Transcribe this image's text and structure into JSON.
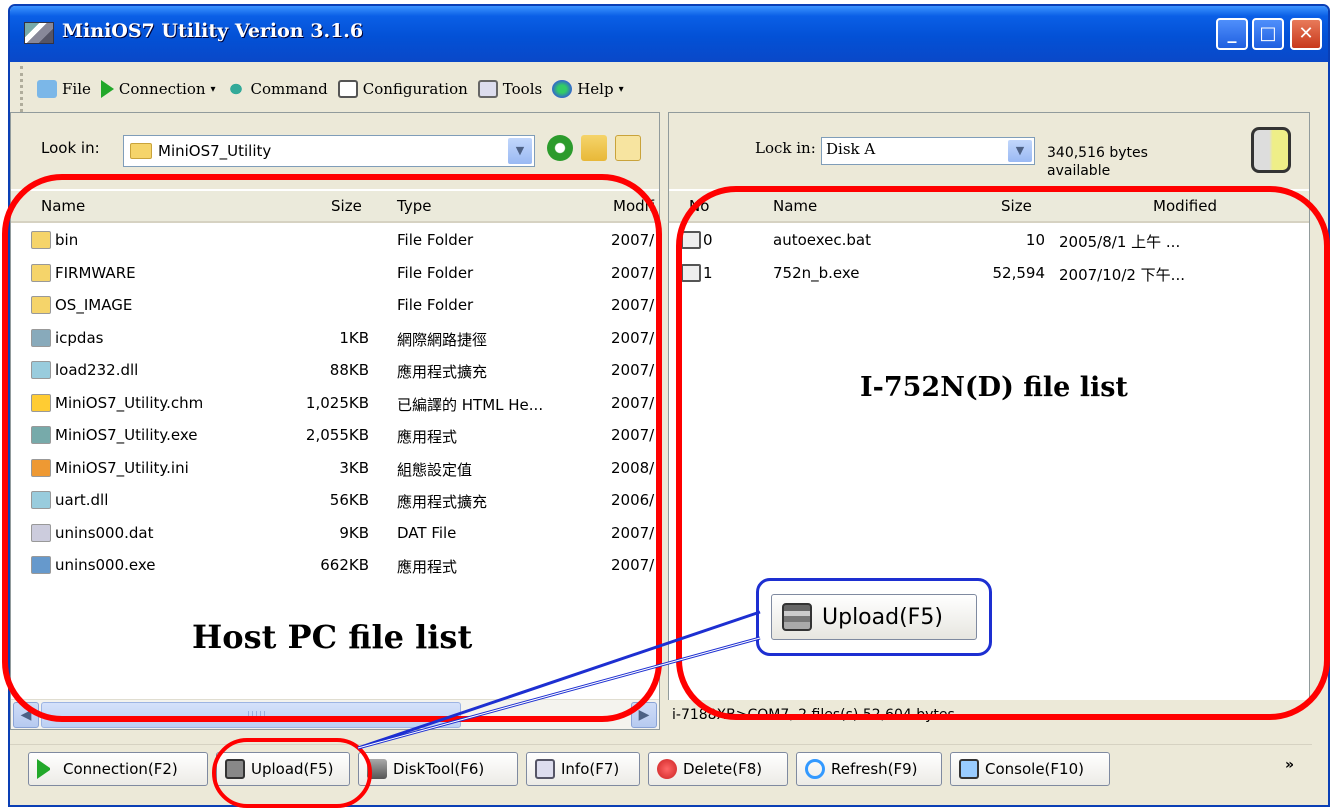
{
  "window": {
    "title": "MiniOS7 Utility Verion 3.1.6"
  },
  "menu": {
    "file": "File",
    "connection": "Connection",
    "command": "Command",
    "configuration": "Configuration",
    "tools": "Tools",
    "help": "Help",
    "arrow": "▾"
  },
  "left": {
    "look_label": "Look in:",
    "look_value": "MiniOS7_Utility",
    "headers": {
      "name": "Name",
      "size": "Size",
      "type": "Type",
      "modified": "Modif"
    },
    "rows": [
      {
        "name": "bin",
        "size": "",
        "type": "File Folder",
        "modified": "2007/"
      },
      {
        "name": "FIRMWARE",
        "size": "",
        "type": "File Folder",
        "modified": "2007/"
      },
      {
        "name": "OS_IMAGE",
        "size": "",
        "type": "File Folder",
        "modified": "2007/"
      },
      {
        "name": "icpdas",
        "size": "1KB",
        "type": "網際網路捷徑",
        "modified": "2007/"
      },
      {
        "name": "load232.dll",
        "size": "88KB",
        "type": "應用程式擴充",
        "modified": "2007/"
      },
      {
        "name": "MiniOS7_Utility.chm",
        "size": "1,025KB",
        "type": "已編譯的 HTML He...",
        "modified": "2007/"
      },
      {
        "name": "MiniOS7_Utility.exe",
        "size": "2,055KB",
        "type": "應用程式",
        "modified": "2007/"
      },
      {
        "name": "MiniOS7_Utility.ini",
        "size": "3KB",
        "type": "組態設定值",
        "modified": "2008/"
      },
      {
        "name": "uart.dll",
        "size": "56KB",
        "type": "應用程式擴充",
        "modified": "2006/"
      },
      {
        "name": "unins000.dat",
        "size": "9KB",
        "type": "DAT File",
        "modified": "2007/"
      },
      {
        "name": "unins000.exe",
        "size": "662KB",
        "type": "應用程式",
        "modified": "2007/"
      }
    ],
    "caption": "Host PC file list",
    "scroll_grip": "|||||"
  },
  "right": {
    "look_label": "Lock in:",
    "look_value": "Disk A",
    "free_line1": "340,516 bytes",
    "free_line2": "available",
    "headers": {
      "no": "No",
      "name": "Name",
      "size": "Size",
      "modified": "Modified"
    },
    "rows": [
      {
        "no": "0",
        "name": "autoexec.bat",
        "size": "10",
        "modified": "2005/8/1 上午 ..."
      },
      {
        "no": "1",
        "name": "752n_b.exe",
        "size": "52,594",
        "modified": "2007/10/2 下午..."
      }
    ],
    "caption": "I-752N(D) file list",
    "status": "i-7188XB>COM7, 2 files(s) 52,604 bytes"
  },
  "upload_callout": {
    "label": "Upload(F5)"
  },
  "toolbar": {
    "connection": "Connection(F2)",
    "upload": "Upload(F5)",
    "disktool": "DiskTool(F6)",
    "info": "Info(F7)",
    "delete": "Delete(F8)",
    "refresh": "Refresh(F9)",
    "console": "Console(F10)",
    "more": "»"
  },
  "colors": {
    "title_bar": "#0351d6",
    "highlight_oval": "#ff0000",
    "callout_border": "#1d2fd1"
  }
}
